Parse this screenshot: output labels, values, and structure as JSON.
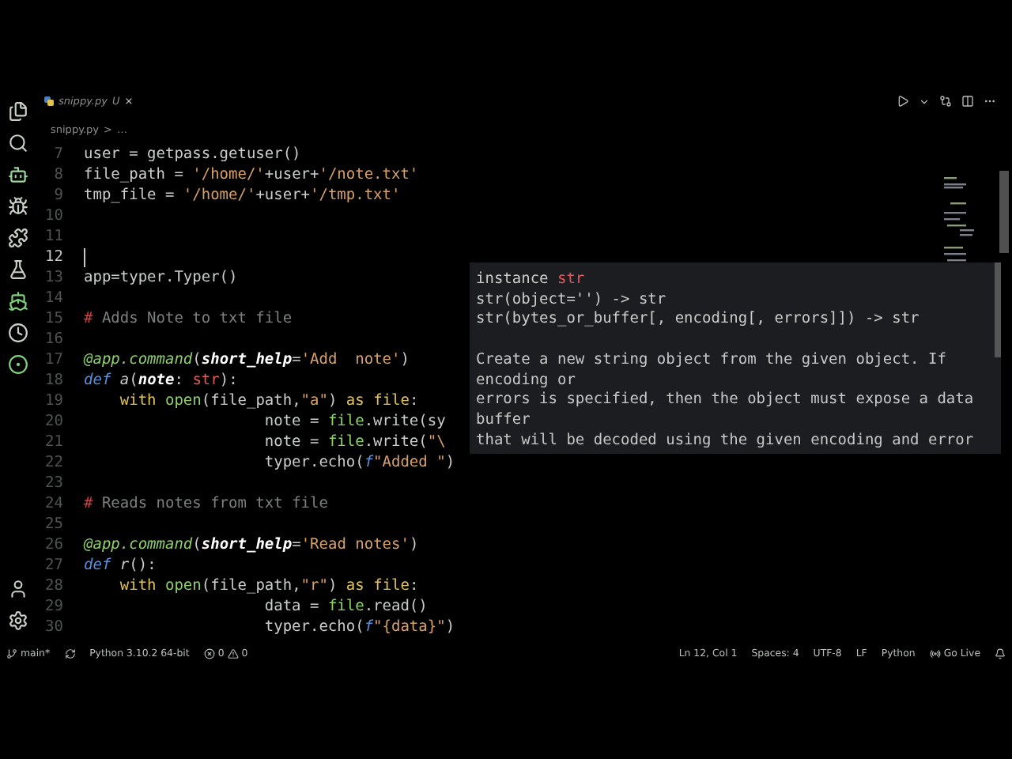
{
  "tab": {
    "name": "snippy.py",
    "status": "U",
    "close": "×"
  },
  "breadcrumb": {
    "file": "snippy.py",
    "separator": ">",
    "rest": "…"
  },
  "code": [
    {
      "number": "7",
      "cursor": false,
      "tokens": [
        {
          "kind": "plain",
          "text": "user = getpass.getuser()"
        }
      ]
    },
    {
      "number": "8",
      "cursor": false,
      "tokens": [
        {
          "kind": "plain",
          "text": "file_path = "
        },
        {
          "kind": "string",
          "text": "'/home/'"
        },
        {
          "kind": "plain",
          "text": "+user+"
        },
        {
          "kind": "string",
          "text": "'/note.txt'"
        }
      ]
    },
    {
      "number": "9",
      "cursor": false,
      "tokens": [
        {
          "kind": "plain",
          "text": "tmp_file = "
        },
        {
          "kind": "string",
          "text": "'/home/'"
        },
        {
          "kind": "plain",
          "text": "+user+"
        },
        {
          "kind": "string",
          "text": "'/tmp.txt'"
        }
      ]
    },
    {
      "number": "10",
      "cursor": false
    },
    {
      "number": "11",
      "cursor": false
    },
    {
      "number": "12",
      "cursor": true
    },
    {
      "number": "13",
      "cursor": false,
      "tokens": [
        {
          "kind": "plain",
          "text": "app=typer.Typer()"
        }
      ]
    },
    {
      "number": "14",
      "cursor": false
    },
    {
      "number": "15",
      "cursor": false,
      "tokens": [
        {
          "kind": "hash",
          "text": "#"
        },
        {
          "kind": "comment",
          "text": " Adds Note to txt file"
        }
      ]
    },
    {
      "number": "16",
      "cursor": false
    },
    {
      "number": "17",
      "cursor": false,
      "tokens": [
        {
          "kind": "decorator",
          "text": "@app.command"
        },
        {
          "kind": "plain",
          "text": "("
        },
        {
          "kind": "param",
          "text": "short_help"
        },
        {
          "kind": "plain",
          "text": "="
        },
        {
          "kind": "string",
          "text": "'Add  note'"
        },
        {
          "kind": "plain",
          "text": ")"
        }
      ]
    },
    {
      "number": "18",
      "cursor": false,
      "tokens": [
        {
          "kind": "keyword",
          "text": "def"
        },
        {
          "kind": "funcname",
          "text": " a"
        },
        {
          "kind": "plain",
          "text": "("
        },
        {
          "kind": "param",
          "text": "note"
        },
        {
          "kind": "plain",
          "text": ": "
        },
        {
          "kind": "type",
          "text": "str"
        },
        {
          "kind": "plain",
          "text": "):"
        }
      ]
    },
    {
      "number": "19",
      "cursor": false,
      "tokens": [
        {
          "kind": "control",
          "text": "    with"
        },
        {
          "kind": "func",
          "text": " open"
        },
        {
          "kind": "plain",
          "text": "(file_path,"
        },
        {
          "kind": "string",
          "text": "\"a\""
        },
        {
          "kind": "plain",
          "text": ") "
        },
        {
          "kind": "control",
          "text": "as"
        },
        {
          "kind": "control",
          "text": " file"
        },
        {
          "kind": "plain",
          "text": ":"
        }
      ]
    },
    {
      "number": "20",
      "cursor": false,
      "tokens": [
        {
          "kind": "plain",
          "text": "                    note = "
        },
        {
          "kind": "func",
          "text": "file"
        },
        {
          "kind": "plain",
          "text": ".write(sy"
        }
      ]
    },
    {
      "number": "21",
      "cursor": false,
      "tokens": [
        {
          "kind": "plain",
          "text": "                    note = "
        },
        {
          "kind": "func",
          "text": "file"
        },
        {
          "kind": "plain",
          "text": ".write("
        },
        {
          "kind": "string",
          "text": "\"\\"
        }
      ]
    },
    {
      "number": "22",
      "cursor": false,
      "tokens": [
        {
          "kind": "plain",
          "text": "                    typer.echo("
        },
        {
          "kind": "keyword",
          "text": "f"
        },
        {
          "kind": "string",
          "text": "\"Added \""
        },
        {
          "kind": "plain",
          "text": ")"
        }
      ]
    },
    {
      "number": "23",
      "cursor": false
    },
    {
      "number": "24",
      "cursor": false,
      "tokens": [
        {
          "kind": "hash",
          "text": "#"
        },
        {
          "kind": "comment",
          "text": " Reads notes from txt file"
        }
      ]
    },
    {
      "number": "25",
      "cursor": false
    },
    {
      "number": "26",
      "cursor": false,
      "tokens": [
        {
          "kind": "decorator",
          "text": "@app.command"
        },
        {
          "kind": "plain",
          "text": "("
        },
        {
          "kind": "param",
          "text": "short_help"
        },
        {
          "kind": "plain",
          "text": "="
        },
        {
          "kind": "string",
          "text": "'Read notes'"
        },
        {
          "kind": "plain",
          "text": ")"
        }
      ]
    },
    {
      "number": "27",
      "cursor": false,
      "tokens": [
        {
          "kind": "keyword",
          "text": "def"
        },
        {
          "kind": "funcname",
          "text": " r"
        },
        {
          "kind": "plain",
          "text": "():"
        }
      ]
    },
    {
      "number": "28",
      "cursor": false,
      "tokens": [
        {
          "kind": "control",
          "text": "    with"
        },
        {
          "kind": "func",
          "text": " open"
        },
        {
          "kind": "plain",
          "text": "(file_path,"
        },
        {
          "kind": "string",
          "text": "\"r\""
        },
        {
          "kind": "plain",
          "text": ") "
        },
        {
          "kind": "control",
          "text": "as"
        },
        {
          "kind": "control",
          "text": " file"
        },
        {
          "kind": "plain",
          "text": ":"
        }
      ]
    },
    {
      "number": "29",
      "cursor": false,
      "tokens": [
        {
          "kind": "plain",
          "text": "                    data = "
        },
        {
          "kind": "func",
          "text": "file"
        },
        {
          "kind": "plain",
          "text": ".read()"
        }
      ]
    },
    {
      "number": "30",
      "cursor": false,
      "tokens": [
        {
          "kind": "plain",
          "text": "                    typer.echo("
        },
        {
          "kind": "keyword",
          "text": "f"
        },
        {
          "kind": "string",
          "text": "\"{data}\""
        },
        {
          "kind": "plain",
          "text": ")"
        }
      ]
    }
  ],
  "hover": {
    "signature": [
      [
        {
          "kind": "plain",
          "text": "instance "
        },
        {
          "kind": "type",
          "text": "str"
        }
      ],
      [
        {
          "kind": "plain",
          "text": "str(object='') -> str"
        }
      ],
      [
        {
          "kind": "plain",
          "text": "str(bytes_or_buffer[, encoding[, errors]]) -> str"
        }
      ]
    ],
    "doc": [
      "Create a new string object from the given object. If",
      "encoding or",
      "errors is specified, then the object must expose a data",
      "buffer",
      "that will be decoded using the given encoding and error"
    ]
  },
  "status_bar": {
    "branch": "main*",
    "interpreter": "Python 3.10.2 64-bit",
    "errors": "0",
    "warnings": "0",
    "position": "Ln 12, Col 1",
    "indent": "Spaces: 4",
    "encoding": "UTF-8",
    "eol": "LF",
    "language": "Python",
    "live": "Go Live"
  }
}
